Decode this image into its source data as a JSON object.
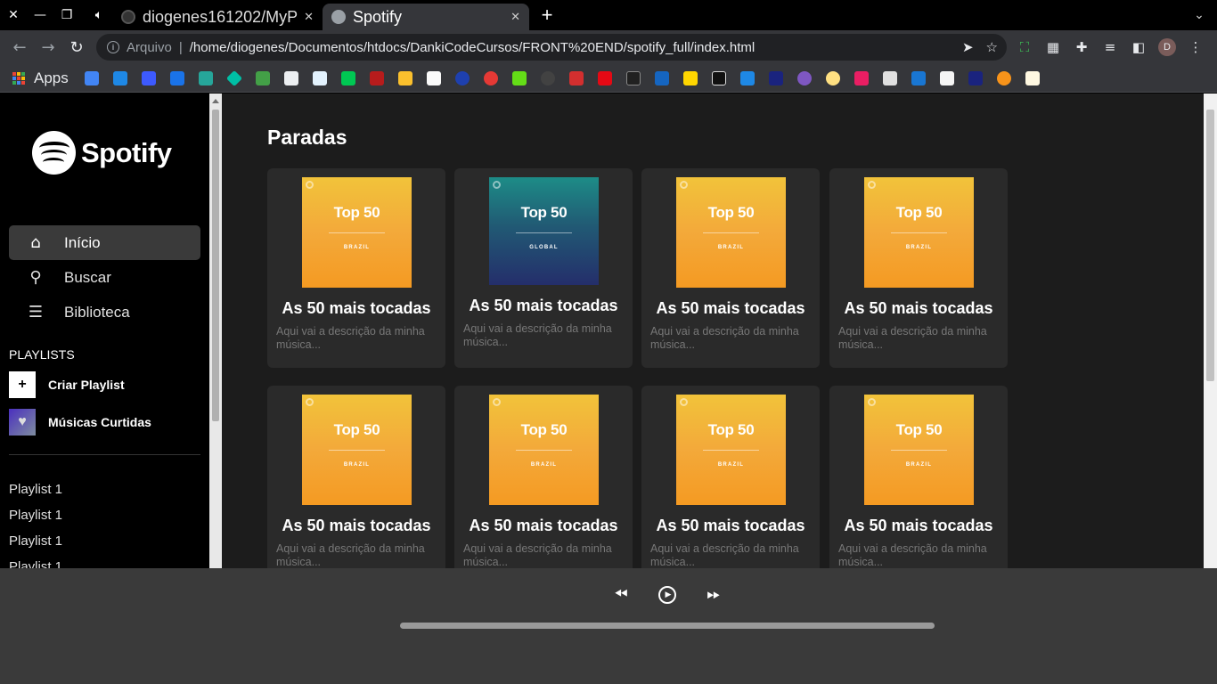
{
  "browser": {
    "tabs": [
      {
        "title": "diogenes161202/MyP",
        "active": false
      },
      {
        "title": "Spotify",
        "active": true
      }
    ],
    "new_tab": "+",
    "address": {
      "label": "Arquivo",
      "separator": "|",
      "url": "/home/diogenes/Documentos/htdocs/DankiCodeCursos/FRONT%20END/spotify_full/index.html"
    },
    "avatar_letter": "D",
    "bookmarks_apps_label": "Apps"
  },
  "sidebar": {
    "logo_text": "Spotify",
    "menu": [
      {
        "label": "Início",
        "icon": "home-icon",
        "active": true
      },
      {
        "label": "Buscar",
        "icon": "search-icon",
        "active": false
      },
      {
        "label": "Biblioteca",
        "icon": "library-icon",
        "active": false
      }
    ],
    "playlists_heading": "PLAYLISTS",
    "create_playlist": "Criar Playlist",
    "create_icon": "+",
    "liked_songs": "Músicas Curtidas",
    "playlists": [
      "Playlist 1",
      "Playlist 1",
      "Playlist 1",
      "Playlist 1"
    ]
  },
  "main": {
    "section_title": "Paradas",
    "cards": [
      {
        "cover_title": "Top 50",
        "cover_subtitle": "BRAZIL",
        "cover_style": "brazil",
        "title": "As 50 mais tocadas",
        "description": "Aqui vai a descrição da minha música..."
      },
      {
        "cover_title": "Top 50",
        "cover_subtitle": "GLOBAL",
        "cover_style": "global",
        "title": "As 50 mais tocadas",
        "description": "Aqui vai a descrição da minha música..."
      },
      {
        "cover_title": "Top 50",
        "cover_subtitle": "BRAZIL",
        "cover_style": "brazil",
        "title": "As 50 mais tocadas",
        "description": "Aqui vai a descrição da minha música..."
      },
      {
        "cover_title": "Top 50",
        "cover_subtitle": "BRAZIL",
        "cover_style": "brazil",
        "title": "As 50 mais tocadas",
        "description": "Aqui vai a descrição da minha música..."
      },
      {
        "cover_title": "Top 50",
        "cover_subtitle": "BRAZIL",
        "cover_style": "brazil",
        "title": "As 50 mais tocadas",
        "description": "Aqui vai a descrição da minha música..."
      },
      {
        "cover_title": "Top 50",
        "cover_subtitle": "BRAZIL",
        "cover_style": "brazil",
        "title": "As 50 mais tocadas",
        "description": "Aqui vai a descrição da minha música..."
      },
      {
        "cover_title": "Top 50",
        "cover_subtitle": "BRAZIL",
        "cover_style": "brazil",
        "title": "As 50 mais tocadas",
        "description": "Aqui vai a descrição da minha música..."
      },
      {
        "cover_title": "Top 50",
        "cover_subtitle": "BRAZIL",
        "cover_style": "brazil",
        "title": "As 50 mais tocadas",
        "description": "Aqui vai a descrição da minha música..."
      }
    ]
  },
  "player": {
    "controls": [
      "previous-icon",
      "play-icon",
      "next-icon"
    ],
    "progress": 0
  },
  "colors": {
    "brazil_cover": "#f4a52a",
    "global_cover": "#215a74",
    "sidebar_bg": "#000000",
    "main_bg": "#1c1c1c",
    "card_bg": "#2a2a2a",
    "player_bg": "#3a3a3a"
  }
}
